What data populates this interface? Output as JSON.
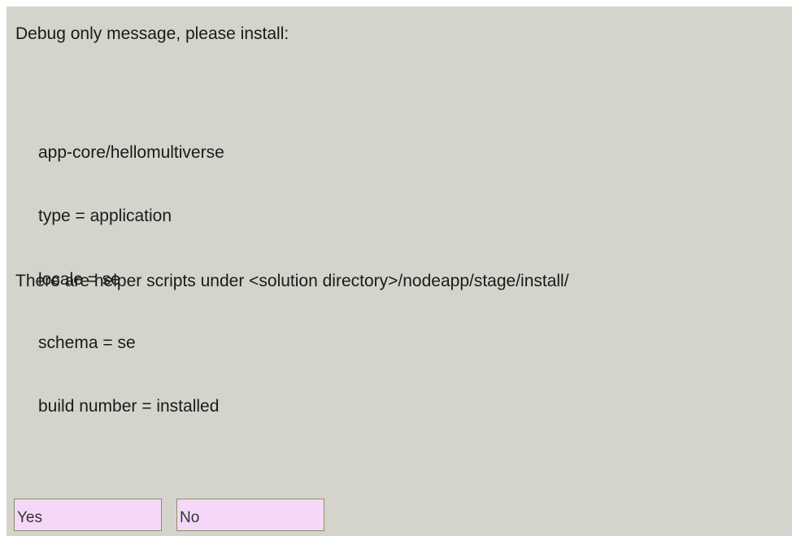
{
  "message": {
    "heading": "Debug only message, please install:",
    "details": [
      "app-core/hellomultiverse",
      "type = application",
      "locale = se",
      "schema = se",
      "build number = installed"
    ],
    "helper": "There are helper scripts under <solution directory>/nodeapp/stage/install/"
  },
  "buttons": {
    "yes_label": "Yes",
    "no_label": "No"
  },
  "colors": {
    "dialog_background": "#d4d4cc",
    "button_background": "#f5d8f7",
    "button_border": "#8e8e66"
  }
}
